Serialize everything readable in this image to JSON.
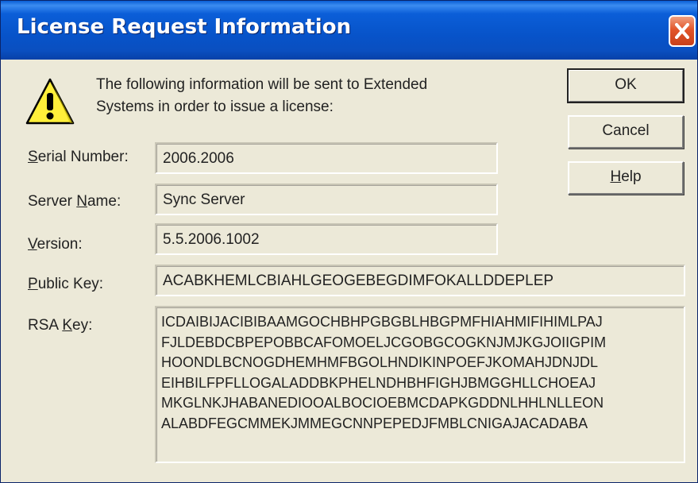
{
  "window": {
    "title": "License Request Information"
  },
  "message": {
    "line1": "The following information will be sent to Extended",
    "line2": "Systems in order to issue a license:"
  },
  "fields": {
    "serial": {
      "label_prefix": "",
      "label_mnemonic": "S",
      "label_rest": "erial Number:",
      "value": "2006.2006"
    },
    "server": {
      "label_prefix": "Server ",
      "label_mnemonic": "N",
      "label_rest": "ame:",
      "value": "Sync Server"
    },
    "version": {
      "label_prefix": "",
      "label_mnemonic": "V",
      "label_rest": "ersion:",
      "value": "5.5.2006.1002"
    },
    "public": {
      "label_prefix": "",
      "label_mnemonic": "P",
      "label_rest": "ublic Key:",
      "value": "ACABKHEMLCBIAHLGEOGEBEGDIMFOKALLDDEPLEP"
    },
    "rsa": {
      "label_prefix": "RSA ",
      "label_mnemonic": "K",
      "label_rest": "ey:",
      "lines": [
        "ICDAIBIJACIBIBAAMGOCHBHPGBGBLHBGPMFHIAHMIFIHIMLPAJ",
        "FJLDEBDCBPEPOBBCAFOMOELJCGOBGCOGKNJMJKGJOIIGPIM",
        "HOONDLBCNOGDHEMHMFBGOLHNDIKINPOEFJKOMAHJDNJDL",
        "EIHBILFPFLLOGALADDBKPHELNDHBHFIGHJBMGGHLLCHOEAJ",
        "MKGLNKJHABANEDIOOALBOCIOEBMCDAPKGDDNLHHLNLLEON",
        "ALABDFEGCMMEKJMMEGCNNPEPEDJFMBLCNIGAJACADABA"
      ]
    }
  },
  "buttons": {
    "ok": "OK",
    "cancel": "Cancel",
    "help_mnemonic": "H",
    "help_rest": "elp"
  },
  "icons": {
    "warning": "warning-icon",
    "close": "close-icon"
  },
  "colors": {
    "titlebar": "#0753c9",
    "close": "#e2552a",
    "window_bg": "#ece9d8"
  }
}
